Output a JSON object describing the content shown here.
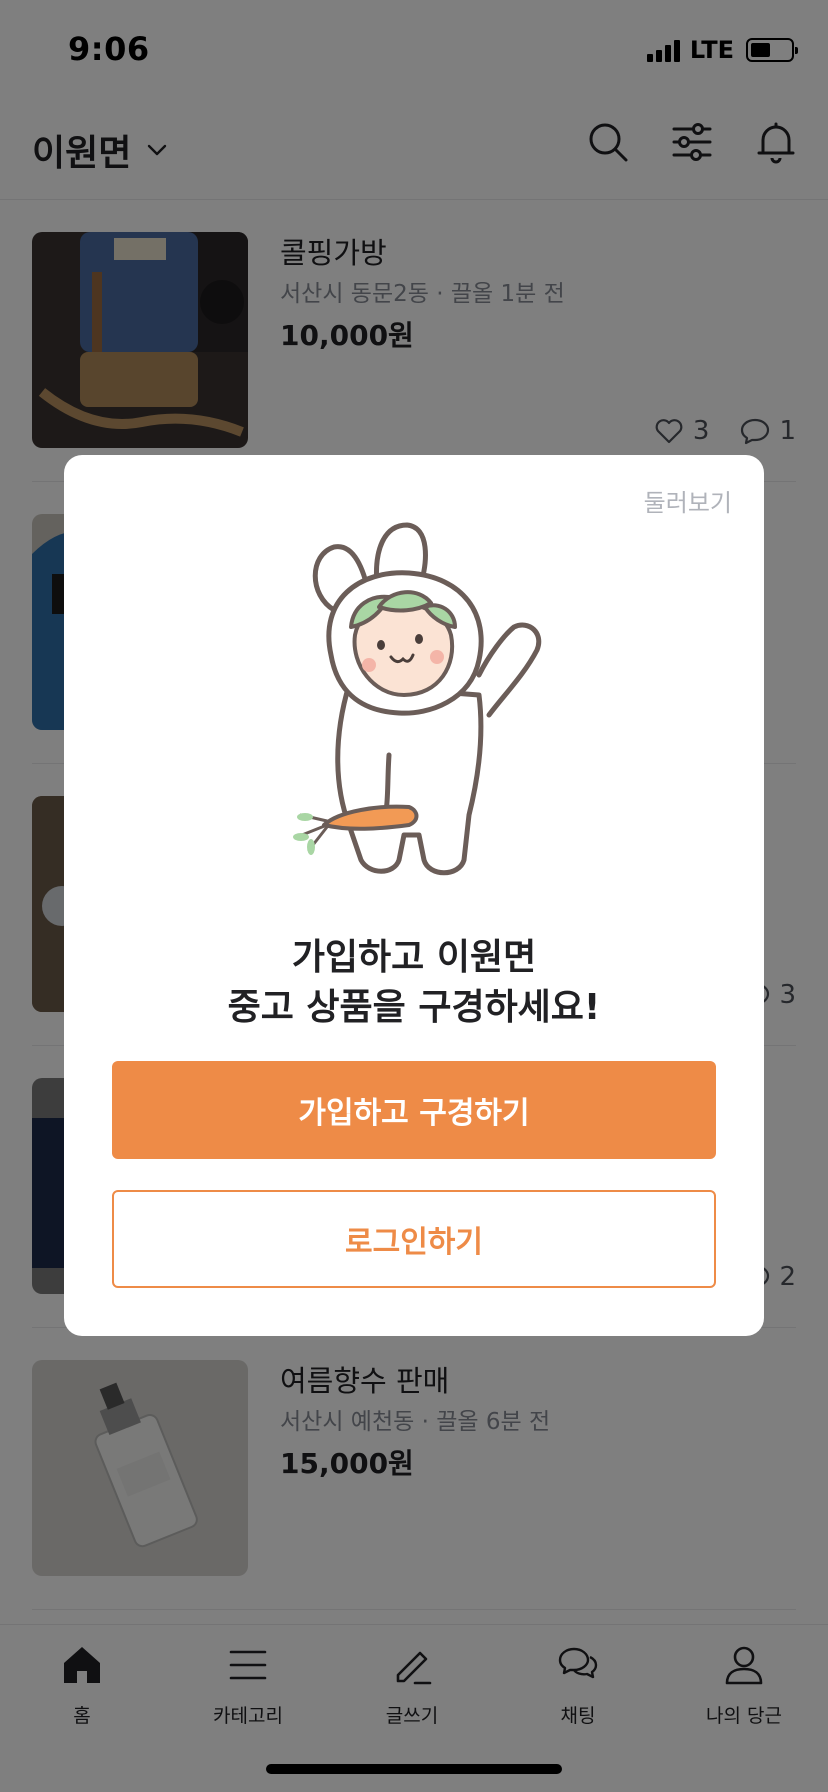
{
  "status_bar": {
    "time": "9:06",
    "network": "LTE"
  },
  "header": {
    "location": "이원면",
    "icons": [
      "chevron-down-icon",
      "search-icon",
      "filter-icon",
      "bell-icon"
    ]
  },
  "feed": {
    "items": [
      {
        "title": "콜핑가방",
        "meta": "서산시 동문2동 · 끌올 1분 전",
        "price": "10,000원",
        "likes": "3",
        "chats": "1"
      },
      {
        "title": "",
        "meta": "",
        "price": "",
        "likes": "",
        "chats": ""
      },
      {
        "title": "",
        "meta": "",
        "price": "",
        "likes": "",
        "chats": "3"
      },
      {
        "title": "",
        "meta": "",
        "price": "",
        "likes": "",
        "chats": "2"
      },
      {
        "title": "여름향수 판매",
        "meta": "서산시 예천동 · 끌올 6분 전",
        "price": "15,000원",
        "likes": "",
        "chats": ""
      }
    ]
  },
  "modal": {
    "browse_label": "둘러보기",
    "title_line1": "가입하고 이원면",
    "title_line2": "중고 상품을 구경하세요!",
    "primary_button": "가입하고 구경하기",
    "secondary_button": "로그인하기"
  },
  "bottom_nav": {
    "items": [
      {
        "label": "홈",
        "icon": "home-icon"
      },
      {
        "label": "카테고리",
        "icon": "menu-icon"
      },
      {
        "label": "글쓰기",
        "icon": "pencil-icon"
      },
      {
        "label": "채팅",
        "icon": "chat-icon"
      },
      {
        "label": "나의 당근",
        "icon": "user-icon"
      }
    ]
  },
  "colors": {
    "accent": "#ee8b47",
    "overlay": "rgba(0,0,0,0.5)"
  }
}
